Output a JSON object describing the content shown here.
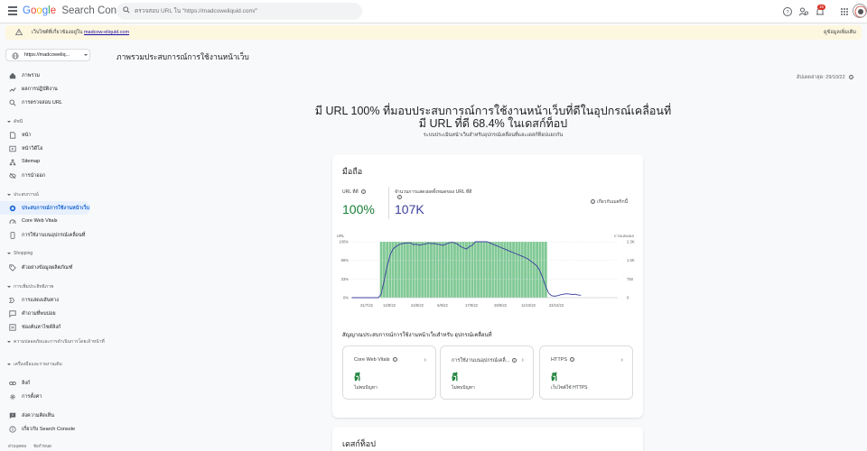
{
  "header": {
    "logo_google": "Google",
    "logo_product": "Search Console",
    "search_placeholder": "ตรวจสอบ URL ใน \"https://madcoweliquid.com/\"",
    "notification_count": "16"
  },
  "banner": {
    "text_prefix": "เว็บไซต์ที่เกี่ยวข้องอยู่ใน",
    "link": "madcow-eliquid.com",
    "more": "ดูข้อมูลเพิ่มเติม"
  },
  "sidebar": {
    "property": "https://madcoweliq...",
    "items_top": [
      {
        "label": "ภาพรวม",
        "icon": "home-icon"
      },
      {
        "label": "ผลการปฏิบัติงาน",
        "icon": "trending-icon"
      },
      {
        "label": "การตรวจสอบ URL",
        "icon": "search-icon"
      }
    ],
    "section_index": "ดัชนี",
    "items_index": [
      {
        "label": "หน้า",
        "icon": "file-icon"
      },
      {
        "label": "หน้าวิดีโอ",
        "icon": "video-icon"
      },
      {
        "label": "Sitemap",
        "icon": "sitemap-icon"
      },
      {
        "label": "การนำออก",
        "icon": "eye-off-icon"
      }
    ],
    "section_experience": "ประสบการณ์",
    "items_experience": [
      {
        "label": "ประสบการณ์การใช้งานหน้าเว็บ",
        "icon": "page-experience-icon"
      },
      {
        "label": "Core Web Vitals",
        "icon": "speed-icon"
      },
      {
        "label": "การใช้งานบนอุปกรณ์เคลื่อนที่",
        "icon": "mobile-icon"
      }
    ],
    "section_shopping": "Shopping",
    "items_shopping": [
      {
        "label": "ตัวอย่างข้อมูลผลิตภัณฑ์",
        "icon": "tag-icon"
      }
    ],
    "section_enhancements": "การเพิ่มประสิทธิภาพ",
    "items_enhancements": [
      {
        "label": "การแสดงเส้นทาง",
        "icon": "breadcrumb-icon"
      },
      {
        "label": "คำถามที่พบบ่อย",
        "icon": "faq-icon"
      },
      {
        "label": "ช่องค้นหาไซต์ลิงก์",
        "icon": "sitelinks-icon"
      }
    ],
    "section_security": "ความปลอดภัยและการดำเนินการโดยเจ้าหน้าที่",
    "section_legacy": "เครื่องมือและรายงานเดิม",
    "items_bottom": [
      {
        "label": "ลิงก์",
        "icon": "link-icon"
      },
      {
        "label": "การตั้งค่า",
        "icon": "gear-icon"
      }
    ],
    "items_footer": [
      {
        "label": "ส่งความคิดเห็น",
        "icon": "feedback-icon"
      },
      {
        "label": "เกี่ยวกับ Search Console",
        "icon": "info-icon"
      }
    ],
    "footer_privacy": "ส่วนบุคคล",
    "footer_terms": "ข้อกำหนด"
  },
  "main": {
    "page_title": "ภาพรวมประสบการณ์การใช้งานหน้าเว็บ",
    "updated": "อัปเดตล่าสุด: 29/10/22",
    "headline_1": "มี URL 100% ที่มอบประสบการณ์การใช้งานหน้าเว็บที่ดีในอุปกรณ์เคลื่อนที่",
    "headline_2": "มี URL ที่ดี 68.4% ในเดสก์ท็อป",
    "subhead": "ระบบประเมินหน้าเว็บสำหรับอุปกรณ์เคลื่อนที่และเดสก์ท็อปแยกกัน",
    "mobile_card": {
      "title": "มือถือ",
      "metric1_label": "URL ที่ดี",
      "metric1_value": "100%",
      "metric2_label": "จำนวนการแสดงผลทั้งหมดของ URL ที่ดี",
      "metric2_value": "107K",
      "learn_more": "เกี่ยวกับเมตริกนี้",
      "signals_title": "สัญญาณประสบการณ์การใช้งานหน้าเว็บสำหรับ อุปกรณ์เคลื่อนที่",
      "signals": [
        {
          "name": "Core Web Vitals",
          "status": "ดี",
          "desc": "ไม่พบปัญหา"
        },
        {
          "name": "การใช้งานบนอุปกรณ์เคลื่...",
          "status": "ดี",
          "desc": "ไม่พบปัญหา"
        },
        {
          "name": "HTTPS",
          "status": "ดี",
          "desc": "เว็บไซต์ใช้ HTTPS"
        }
      ]
    },
    "desktop_card": {
      "title": "เดสก์ท็อป"
    }
  },
  "chart_data": {
    "type": "bar",
    "left_axis_label": "URL",
    "right_axis_label": "การแสดงผล",
    "left_ticks": [
      "100%",
      "66%",
      "33%",
      "0%"
    ],
    "right_ticks": [
      "2.3K",
      "1.5K",
      "750",
      "0"
    ],
    "x_ticks": [
      "31/7/22",
      "12/8/22",
      "24/8/22",
      "5/9/22",
      "17/9/22",
      "29/9/22",
      "11/10/22",
      "23/10/22"
    ],
    "bar_series": {
      "name": "URL ที่ดี",
      "color": "#81c995",
      "start_index": 10,
      "end_index": 66,
      "value_percent": 100
    },
    "days": 91,
    "line_series": {
      "name": "การแสดงผล",
      "color": "#3c3f9c",
      "values": [
        0,
        0,
        0,
        0,
        0,
        0,
        0,
        0,
        0,
        0,
        150,
        700,
        1300,
        1750,
        2000,
        2100,
        2180,
        2220,
        2240,
        2250,
        2250,
        2180,
        2200,
        2150,
        2190,
        2200,
        2250,
        2220,
        2230,
        2200,
        2180,
        2150,
        2200,
        2250,
        2280,
        2250,
        2200,
        2100,
        2050,
        2000,
        2100,
        2150,
        2300,
        2350,
        2300,
        2350,
        2300,
        2250,
        2200,
        2150,
        2100,
        2050,
        2000,
        1950,
        1900,
        1850,
        1800,
        1750,
        1700,
        1650,
        1580,
        1500,
        1400,
        1300,
        1100,
        800,
        450,
        180,
        80,
        60,
        80,
        120,
        140,
        160,
        150,
        130,
        140,
        110,
        100
      ]
    }
  }
}
